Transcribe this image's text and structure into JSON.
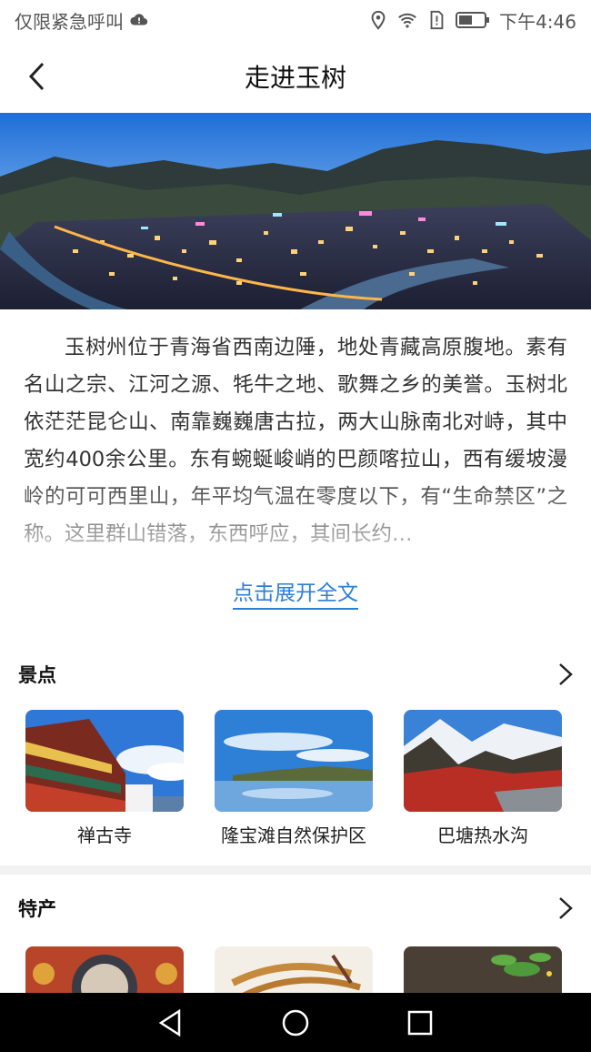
{
  "status_bar": {
    "carrier": "仅限紧急呼叫",
    "time": "下午4:46"
  },
  "header": {
    "title": "走进玉树"
  },
  "intro": {
    "text": "玉树州位于青海省西南边陲，地处青藏高原腹地。素有名山之宗、江河之源、牦牛之地、歌舞之乡的美誉。玉树北依茫茫昆仑山、南靠巍巍唐古拉，两大山脉南北对峙，其中宽约400余公里。东有蜿蜒峻峭的巴颜喀拉山，西有缓坡漫岭的可可西里山，年平均气温在零度以下，有“生命禁区”之称。这里群山错落，东西呼应，其间长约…",
    "expand_label": "点击展开全文"
  },
  "attractions": {
    "title": "景点",
    "items": [
      {
        "label": "禅古寺"
      },
      {
        "label": "隆宝滩自然保护区"
      },
      {
        "label": "巴塘热水沟"
      }
    ]
  },
  "specialties": {
    "title": "特产"
  },
  "colors": {
    "accent": "#2b7fd8",
    "nav_bg": "#000000",
    "divider": "#f2f2f2"
  }
}
